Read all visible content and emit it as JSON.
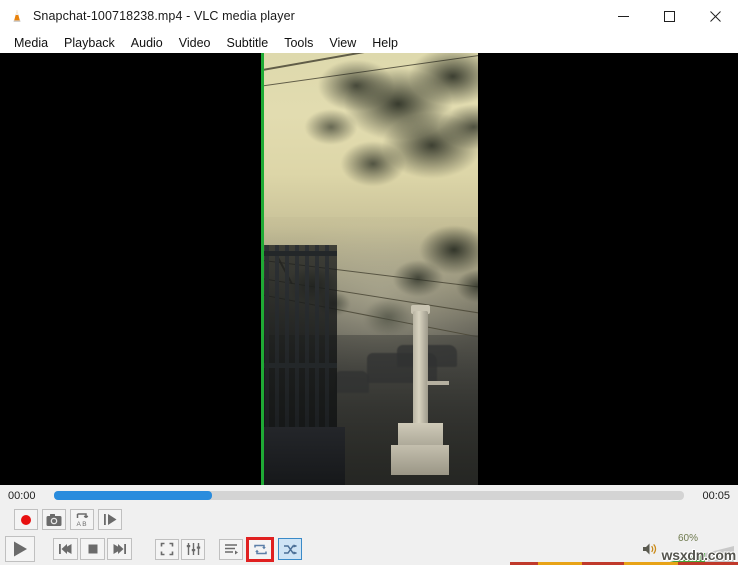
{
  "window": {
    "title": "Snapchat-100718238.mp4 - VLC media player",
    "app_icon": "vlc-cone-icon",
    "controls": {
      "minimize": "minimize-icon",
      "maximize": "maximize-icon",
      "close": "close-icon"
    }
  },
  "menubar": {
    "items": [
      {
        "label": "Media"
      },
      {
        "label": "Playback"
      },
      {
        "label": "Audio"
      },
      {
        "label": "Video"
      },
      {
        "label": "Subtitle"
      },
      {
        "label": "Tools"
      },
      {
        "label": "View"
      },
      {
        "label": "Help"
      }
    ]
  },
  "video": {
    "description": "Sepia-toned foggy street scene with tall trees, power lines, an iron gate on the left and a white stone pillar monument on the right",
    "edge_highlight_color": "#1faa35",
    "letterbox_color": "#000000"
  },
  "seekbar": {
    "elapsed": "00:00",
    "duration": "00:05",
    "progress_percent": 25,
    "fill_color": "#2a8cdd",
    "track_color": "#d4d4d4"
  },
  "advanced_controls": {
    "buttons": [
      {
        "name": "record-button",
        "icon": "record-icon",
        "label": "Record"
      },
      {
        "name": "snapshot-button",
        "icon": "camera-icon",
        "label": "Take a snapshot"
      },
      {
        "name": "ab-loop-button",
        "icon": "ab-loop-icon",
        "label": "Loop from point A to point B continuously"
      },
      {
        "name": "frame-by-frame-button",
        "icon": "frame-step-icon",
        "label": "Frame by frame"
      }
    ]
  },
  "transport_controls": {
    "buttons": [
      {
        "name": "play-button",
        "icon": "play-icon",
        "label": "Play"
      },
      {
        "name": "previous-button",
        "icon": "previous-icon",
        "label": "Previous media in playlist"
      },
      {
        "name": "stop-button",
        "icon": "stop-icon",
        "label": "Stop playback"
      },
      {
        "name": "next-button",
        "icon": "next-icon",
        "label": "Next media in playlist"
      },
      {
        "name": "fullscreen-button",
        "icon": "fullscreen-icon",
        "label": "Toggle the video in fullscreen"
      },
      {
        "name": "extended-settings-button",
        "icon": "equalizer-icon",
        "label": "Show extended settings"
      },
      {
        "name": "playlist-button",
        "icon": "playlist-icon",
        "label": "Show playlist"
      },
      {
        "name": "loop-button",
        "icon": "loop-icon",
        "label": "Click to toggle between loop all, loop one and no loop"
      },
      {
        "name": "random-button",
        "icon": "shuffle-icon",
        "label": "Random"
      }
    ],
    "loop_highlight_color": "#e02020",
    "random_selected_color": "#3a8ac8"
  },
  "volume": {
    "icon": "speaker-icon",
    "level_label": "60%",
    "level_percent": 60,
    "fill_color": "#4aa33c"
  },
  "watermark": {
    "text": "wsxdn.com"
  }
}
